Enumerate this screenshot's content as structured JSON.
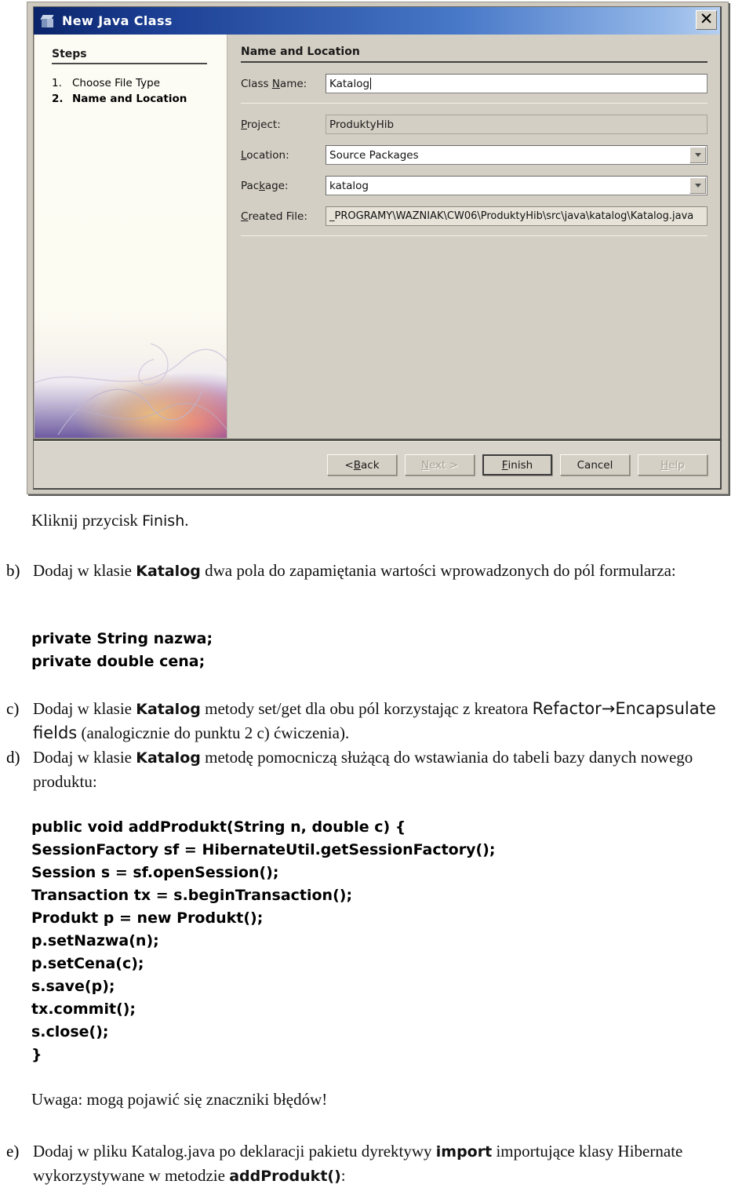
{
  "dialog": {
    "title": "New Java Class",
    "title_icon": "java-cube-icon",
    "close_icon": "close-icon",
    "steps_heading": "Steps",
    "steps": [
      {
        "num": "1.",
        "label": "Choose File Type",
        "current": false
      },
      {
        "num": "2.",
        "label": "Name and Location",
        "current": true
      }
    ],
    "content_heading": "Name and Location",
    "fields": [
      {
        "name": "class-name",
        "label_pre": "Class ",
        "label_mn": "N",
        "label_post": "ame:",
        "value": "Katalog",
        "type": "text",
        "caret": true
      },
      {
        "name": "project",
        "label_pre": "",
        "label_mn": "P",
        "label_post": "roject:",
        "value": "ProduktyHib",
        "type": "readonly",
        "caret": false
      },
      {
        "name": "location",
        "label_pre": "",
        "label_mn": "L",
        "label_post": "ocation:",
        "value": "Source Packages",
        "type": "combo",
        "caret": false
      },
      {
        "name": "package",
        "label_pre": "Pac",
        "label_mn": "k",
        "label_post": "age:",
        "value": "katalog",
        "type": "combo",
        "caret": false
      },
      {
        "name": "created-file",
        "label_pre": "",
        "label_mn": "C",
        "label_post": "reated File:",
        "value": "_PROGRAMY\\WAZNIAK\\CW06\\ProduktyHib\\src\\java\\katalog\\Katalog.java",
        "type": "path",
        "caret": false
      }
    ],
    "buttons": [
      {
        "name": "back",
        "pre": "< ",
        "mn": "B",
        "post": "ack",
        "state": "enabled"
      },
      {
        "name": "next",
        "pre": "",
        "mn": "N",
        "post": "ext >",
        "state": "disabled"
      },
      {
        "name": "finish",
        "pre": "",
        "mn": "F",
        "post": "inish",
        "state": "default"
      },
      {
        "name": "cancel",
        "pre": "",
        "mn": "",
        "post": "Cancel",
        "state": "enabled"
      },
      {
        "name": "help",
        "pre": "",
        "mn": "H",
        "post": "elp",
        "state": "disabled"
      }
    ]
  },
  "doc": {
    "finish_line": {
      "text_pre": "Kliknij przycisk ",
      "code": "Finish",
      "text_post": "."
    },
    "item_b": {
      "mark": "b)",
      "pre": "Dodaj w klasie ",
      "code": "Katalog",
      "post": " dwa pola do zapamiętania wartości wprowadzonych do pól formularza:"
    },
    "code_fields": "private String nazwa;\nprivate double cena;",
    "item_c": {
      "mark": "c)",
      "pre": "Dodaj w klasie ",
      "code1": "Katalog",
      "mid": " metody set/get dla obu pól korzystając z kreatora ",
      "code2": "Refactor→Encapsulate fields",
      "post": " (analogicznie do punktu 2 c) ćwiczenia)."
    },
    "item_d": {
      "mark": "d)",
      "pre": "Dodaj w klasie ",
      "code": "Katalog",
      "post": " metodę pomocniczą służącą do wstawiania do tabeli bazy danych nowego produktu:"
    },
    "code_method": "public void addProdukt(String n, double c) {\nSessionFactory sf = HibernateUtil.getSessionFactory();\nSession s = sf.openSession();\nTransaction tx = s.beginTransaction();\nProdukt p = new Produkt();\np.setNazwa(n);\np.setCena(c);\ns.save(p);\ntx.commit();\ns.close();\n}",
    "note": "Uwaga: mogą pojawić się znaczniki błędów!",
    "item_e": {
      "mark": "e)",
      "pre": "Dodaj w pliku Katalog.java po deklaracji pakietu dyrektywy ",
      "code1": "import",
      "mid": " importujące klasy Hibernate wykorzystywane w metodzie ",
      "code2": "addProdukt()",
      "post": ":"
    }
  },
  "colors": {
    "titlebar_left": "#0a246a",
    "titlebar_right": "#b6d0f0",
    "dialog_bg": "#d4cfc4",
    "steps_bg": "#fdfcf4"
  }
}
